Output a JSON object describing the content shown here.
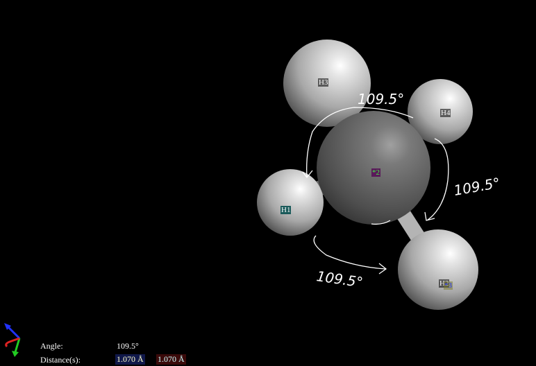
{
  "viewer": {
    "background": "#000000",
    "atoms": [
      {
        "label": "H3"
      },
      {
        "label": "H4"
      },
      {
        "label": "H1",
        "marker": "*1"
      },
      {
        "label": "C2",
        "marker": "*2"
      },
      {
        "label": "H2",
        "marker": "*3"
      }
    ],
    "annotations": [
      "109.5°",
      "109.5°",
      "109.5°"
    ],
    "axes_icon": "xyz-axes-icon"
  },
  "info": {
    "angle_label": "Angle:",
    "angle_value": "109.5°",
    "distance_label": "Distance(s):",
    "distance_1": "1.070 Å",
    "distance_2": "1.070 Å",
    "distance_1_color": "#1a2a8a",
    "distance_2_color": "#7a1a1a"
  }
}
